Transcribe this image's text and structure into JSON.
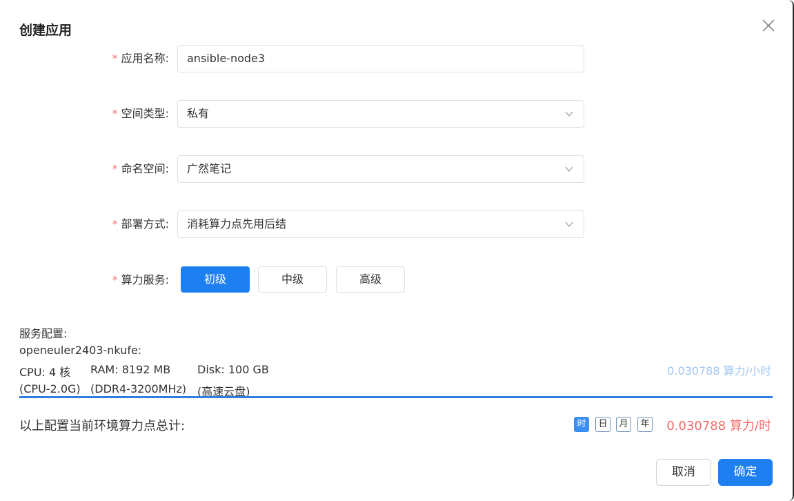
{
  "dialog": {
    "title": "创建应用"
  },
  "form": {
    "app_name": {
      "label": "应用名称:",
      "value": "ansible-node3"
    },
    "space_type": {
      "label": "空间类型:",
      "value": "私有"
    },
    "namespace": {
      "label": "命名空间:",
      "value": "广然笔记"
    },
    "deploy_mode": {
      "label": "部署方式:",
      "value": "消耗算力点先用后结"
    },
    "compute_service": {
      "label": "算力服务:",
      "tiers": [
        "初级",
        "中级",
        "高级"
      ],
      "selected": "初级"
    }
  },
  "config": {
    "heading": "服务配置:",
    "name": "openeuler2403-nkufe:",
    "cpu": "CPU: 4 核",
    "ram": "RAM: 8192 MB",
    "disk": "Disk: 100 GB",
    "cpu_detail": "(CPU-2.0G)",
    "ram_detail": "(DDR4-3200MHz)",
    "disk_detail": "(高速云盘)",
    "rate": "0.030788 算力/小时"
  },
  "summary": {
    "label": "以上配置当前环境算力点总计:",
    "periods": [
      "时",
      "日",
      "月",
      "年"
    ],
    "selected_period": "时",
    "total": "0.030788 算力/时"
  },
  "buttons": {
    "cancel": "取消",
    "ok": "确定"
  },
  "colors": {
    "primary": "#1e7ff0",
    "required": "#f56c6c",
    "rate_light": "#9fc6f2"
  }
}
